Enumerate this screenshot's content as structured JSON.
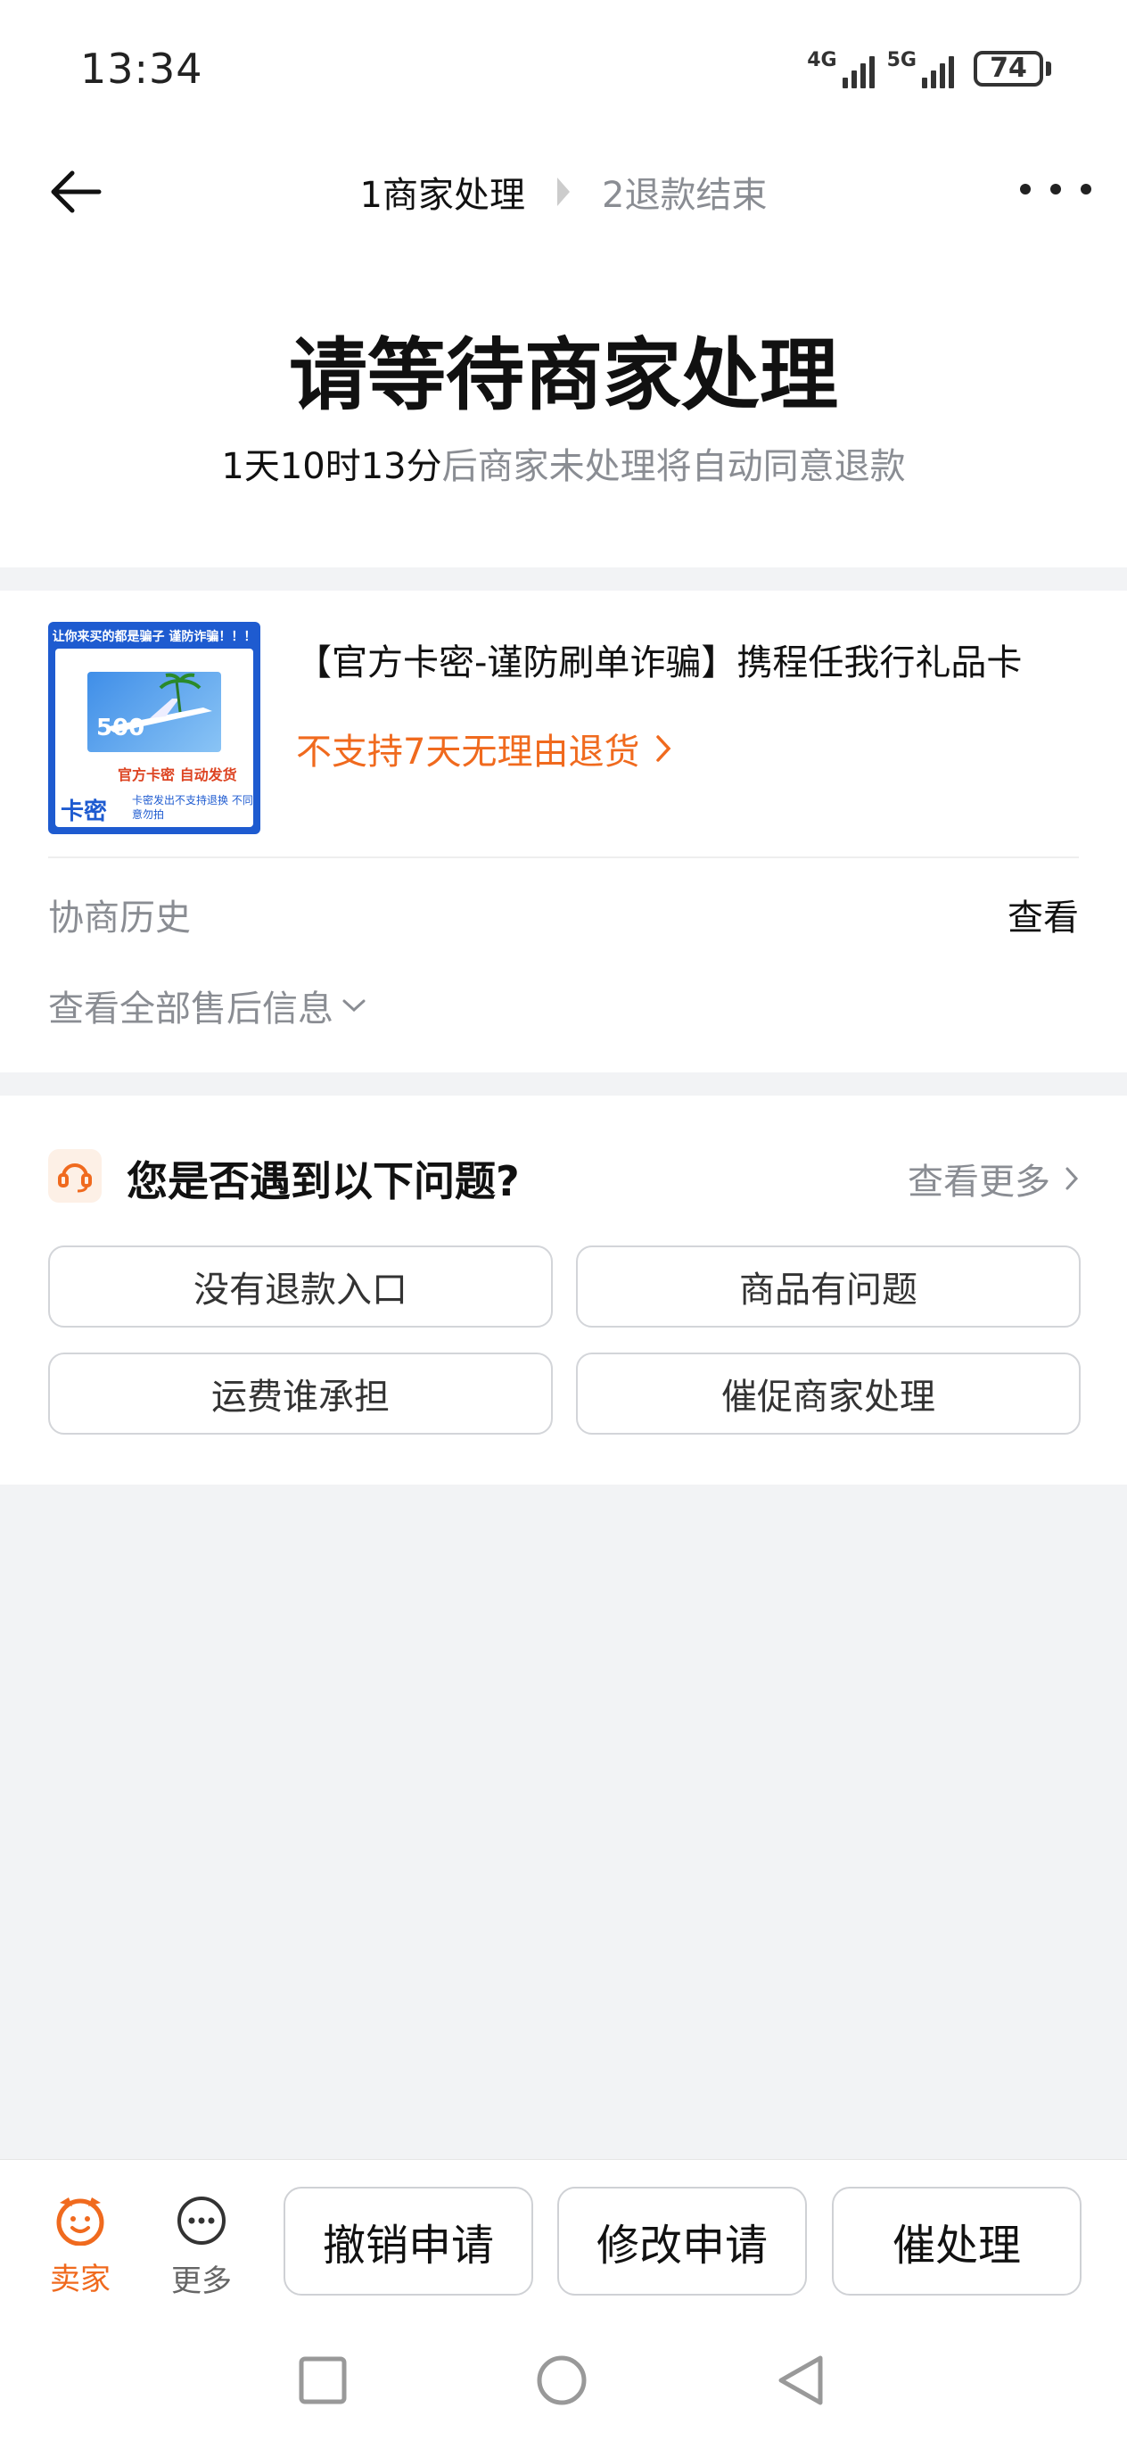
{
  "status_bar": {
    "time": "13:34",
    "network1": "4G",
    "network2": "5G",
    "battery": "74"
  },
  "header": {
    "steps": [
      {
        "label": "1商家处理",
        "active": true
      },
      {
        "label": "2退款结束",
        "active": false
      }
    ],
    "back_icon": "arrow-left-icon",
    "more_icon": "more-dots-icon"
  },
  "hero": {
    "title": "请等待商家处理",
    "countdown": "1天10时13分",
    "subtitle_suffix": "后商家未处理将自动同意退款"
  },
  "product": {
    "title": "【官方卡密-谨防刷单诈骗】携程任我行礼品卡",
    "return_policy": "不支持7天无理由退货",
    "thumbnail": {
      "top_text": "让你来买的都是骗子 谨防诈骗！！！",
      "amount": "500",
      "label1": "官方卡密 自动发货",
      "kami": "卡密",
      "label2": "卡密发出不支持退换 不同意勿拍"
    },
    "history_label": "协商历史",
    "history_link": "查看",
    "aftersale_toggle": "查看全部售后信息"
  },
  "problems": {
    "title": "您是否遇到以下问题?",
    "more": "查看更多",
    "items": [
      "没有退款入口",
      "商品有问题",
      "运费谁承担",
      "催促商家处理"
    ]
  },
  "bottom_bar": {
    "seller_label": "卖家",
    "more_label": "更多",
    "actions": [
      "撤销申请",
      "修改申请",
      "催处理"
    ]
  },
  "colors": {
    "accent_orange": "#f06a1e",
    "muted_text": "#8a8d93",
    "background": "#f2f3f5"
  }
}
